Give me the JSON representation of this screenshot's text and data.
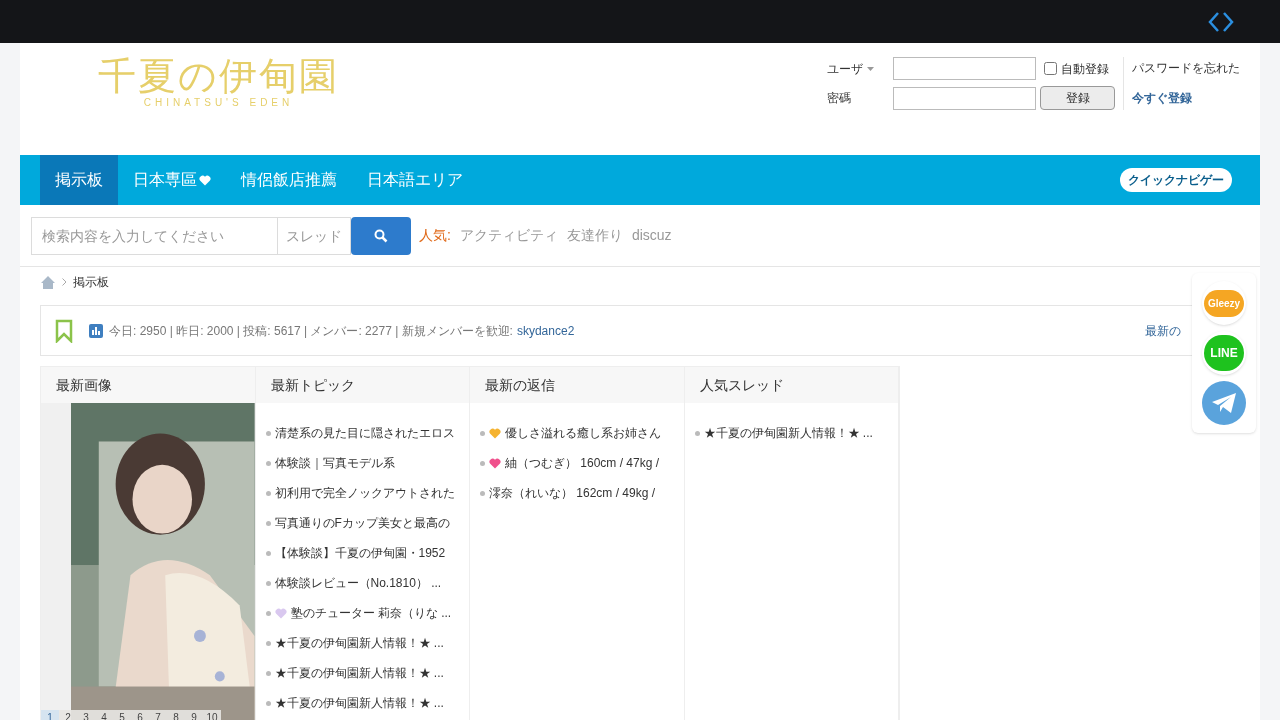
{
  "logo": {
    "title": "千夏の伊甸園",
    "subtitle": "CHINATSU'S EDEN"
  },
  "login": {
    "user_label": "ユーザ",
    "password_label": "密碼",
    "remember": {
      "label": "自動登録",
      "checked": false
    },
    "login_button": "登録",
    "forgot_link": "パスワードを忘れた",
    "register_link": "今すぐ登録"
  },
  "nav": {
    "items": [
      {
        "label": "掲示板",
        "selected": true,
        "heart": false
      },
      {
        "label": "日本専區",
        "selected": false,
        "heart": true
      },
      {
        "label": "情侶飯店推薦",
        "selected": false,
        "heart": false
      },
      {
        "label": "日本語エリア",
        "selected": false,
        "heart": false
      }
    ],
    "quick_nav": "クイックナビゲー"
  },
  "search": {
    "placeholder": "検索内容を入力してください",
    "scope": "スレッド",
    "hot_label": "人気:",
    "hot_links": [
      "アクティビティ",
      "友達作り",
      "discuz"
    ]
  },
  "breadcrumb": [
    "掲示板"
  ],
  "stats": {
    "text": "今日: 2950 | 昨日: 2000 | 投稿: 5617 | メンバー: 2277 | 新規メンバーを歓迎:",
    "new_member": "skydance2",
    "right_link": "最新の"
  },
  "columns": [
    {
      "title": "最新画像",
      "pages": [
        {
          "label": "1",
          "selected": true
        },
        {
          "label": "2",
          "selected": false
        },
        {
          "label": "3",
          "selected": false
        },
        {
          "label": "4",
          "selected": false
        },
        {
          "label": "5",
          "selected": false
        },
        {
          "label": "6",
          "selected": false
        },
        {
          "label": "7",
          "selected": false
        },
        {
          "label": "8",
          "selected": false
        },
        {
          "label": "9",
          "selected": false
        },
        {
          "label": "10",
          "selected": false
        }
      ]
    },
    {
      "title": "最新トピック",
      "kind": "list",
      "items": [
        {
          "text": "清楚系の見た目に隠されたエロス"
        },
        {
          "text": "体験談｜写真モデル系"
        },
        {
          "text": "初利用で完全ノックアウトされた"
        },
        {
          "text": "写真通りのFカップ美女と最高の"
        },
        {
          "text": "【体験談】千夏の伊甸園・1952"
        },
        {
          "text": "体験談レビュー（No.1810） ..."
        },
        {
          "text": "塾のチューター 莉奈（りな ...",
          "color": "#d9c8ef"
        },
        {
          "text": "★千夏の伊甸園新人情報！★ ..."
        },
        {
          "text": "★千夏の伊甸園新人情報！★ ..."
        },
        {
          "text": "★千夏の伊甸園新人情報！★ ..."
        }
      ]
    },
    {
      "title": "最新の返信",
      "kind": "list",
      "items": [
        {
          "text": "優しさ溢れる癒し系お姉さん",
          "color": "#f5b330"
        },
        {
          "text": "紬（つむぎ） 160cm / 47kg /",
          "color": "#f0508c"
        },
        {
          "text": "澪奈（れいな） 162cm / 49kg /"
        }
      ]
    },
    {
      "title": "人気スレッド",
      "kind": "list",
      "items": [
        {
          "text": "★千夏の伊甸園新人情報！★ ..."
        }
      ]
    }
  ],
  "social": [
    {
      "kind": "gleezy",
      "label": "Gleezy"
    },
    {
      "kind": "line",
      "label": "LINE"
    },
    {
      "kind": "telegram"
    }
  ]
}
